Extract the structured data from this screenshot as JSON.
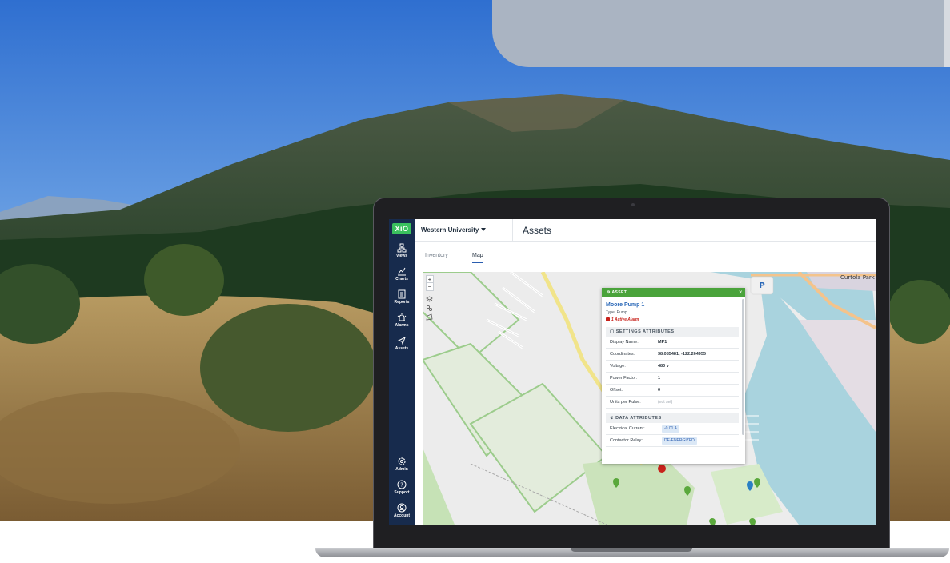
{
  "app": {
    "logo_text": "XiO",
    "org_name": "Western University",
    "page_title": "Assets",
    "brand_color": "#172b4d",
    "accent_color": "#4aa33b"
  },
  "sidebar": {
    "top_items": [
      {
        "label": "Views",
        "icon": "views-icon"
      },
      {
        "label": "Charts",
        "icon": "charts-icon"
      },
      {
        "label": "Reports",
        "icon": "reports-icon"
      },
      {
        "label": "Alarms",
        "icon": "alarms-icon"
      },
      {
        "label": "Assets",
        "icon": "assets-icon"
      }
    ],
    "bottom_items": [
      {
        "label": "Admin",
        "icon": "gear-icon"
      },
      {
        "label": "Support",
        "icon": "help-icon"
      },
      {
        "label": "Account",
        "icon": "user-icon"
      }
    ]
  },
  "tabs": [
    {
      "label": "Inventory",
      "active": false
    },
    {
      "label": "Map",
      "active": true
    }
  ],
  "map": {
    "zoom_in": "+",
    "zoom_out": "−",
    "labels": {
      "park": "Curtola Park",
      "parking": "P"
    }
  },
  "popup": {
    "header": "ASSET",
    "close": "×",
    "asset_name": "Moore Pump 1",
    "asset_type": "Type: Pump",
    "alarm": "1 Active Alarm",
    "settings_title": "SETTINGS ATTRIBUTES",
    "settings": [
      {
        "label": "Display Name:",
        "value": "MP1"
      },
      {
        "label": "Coordinates:",
        "value": "38.085481, -122.264955"
      },
      {
        "label": "Voltage:",
        "value": "480 v"
      },
      {
        "label": "Power Factor:",
        "value": "1"
      },
      {
        "label": "Offset:",
        "value": "0"
      },
      {
        "label": "Units per Pulse:",
        "value": "(not set)"
      }
    ],
    "data_title": "DATA ATTRIBUTES",
    "data": [
      {
        "label": "Electrical Current:",
        "value": "-0.01 A"
      },
      {
        "label": "Contactor Relay:",
        "value": "DE-ENERGIZED"
      }
    ]
  }
}
